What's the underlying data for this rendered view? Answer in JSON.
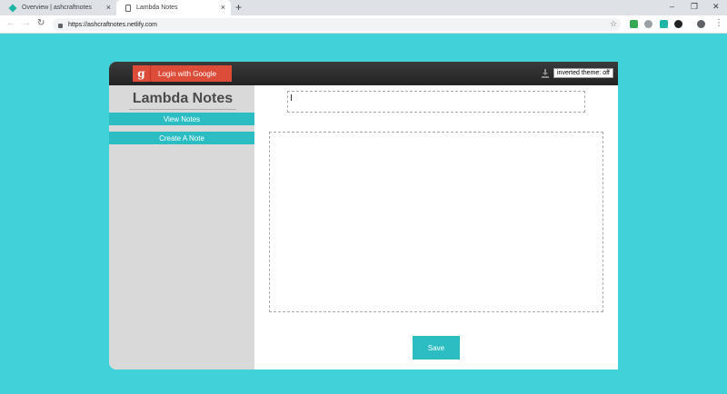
{
  "browser": {
    "tabs": [
      {
        "title": "Overview | ashcraftnotes",
        "active": false
      },
      {
        "title": "Lambda Notes",
        "active": true
      }
    ],
    "close_glyph": "×",
    "new_tab_glyph": "+",
    "url": "https://ashcraftnotes.netlify.com",
    "icons": {
      "back": "←",
      "forward": "→",
      "reload": "↻",
      "star": "☆",
      "menu": "⋮",
      "minimize": "–",
      "restore": "❐",
      "window_close": "✕"
    },
    "extension_colors": [
      "#34a853",
      "#9aa0a6",
      "#1fb5a4",
      "#202124",
      "#5f6368"
    ]
  },
  "header": {
    "google_logo": "g",
    "login_label": "Login with Google",
    "theme_toggle_label": "inverted theme: off"
  },
  "sidebar": {
    "brand": "Lambda Notes",
    "items": [
      {
        "label": "View Notes"
      },
      {
        "label": "Create A Note"
      }
    ]
  },
  "form": {
    "title_value": "",
    "content_value": "",
    "save_label": "Save"
  },
  "colors": {
    "page_background": "#40d1d9",
    "accent": "#2bbdc2",
    "google_red": "#dd4b39",
    "sidebar_bg": "#d9d9d9",
    "header_bg": "#2c2c2c"
  }
}
